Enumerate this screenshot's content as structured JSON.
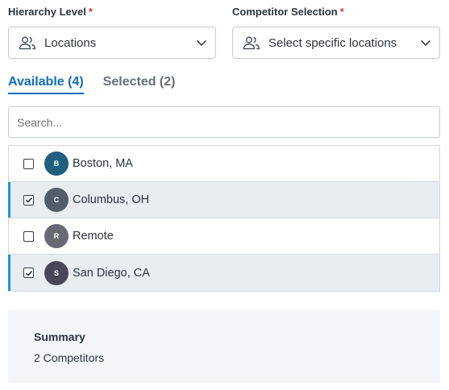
{
  "hierarchy": {
    "label": "Hierarchy Level",
    "required_mark": "*",
    "value": "Locations"
  },
  "competitor": {
    "label": "Competitor Selection",
    "required_mark": "*",
    "value": "Select specific locations"
  },
  "tabs": [
    {
      "label": "Available (4)",
      "active": true
    },
    {
      "label": "Selected (2)",
      "active": false
    }
  ],
  "search": {
    "placeholder": "Search...",
    "value": ""
  },
  "items": [
    {
      "initial": "B",
      "label": "Boston, MA",
      "checked": false,
      "avatar_color": "#1f5f80"
    },
    {
      "initial": "C",
      "label": "Columbus, OH",
      "checked": true,
      "avatar_color": "#535c6a"
    },
    {
      "initial": "R",
      "label": "Remote",
      "checked": false,
      "avatar_color": "#656a74"
    },
    {
      "initial": "S",
      "label": "San Diego, CA",
      "checked": true,
      "avatar_color": "#4a4658"
    }
  ],
  "summary": {
    "title": "Summary",
    "count_text": "2 Competitors"
  },
  "colors": {
    "accent": "#0f6cbd",
    "selection_bar": "#2391dd",
    "required": "#d6333a",
    "selected_row_bg": "#e9edf2"
  },
  "icons": {
    "select_icon": "people-icon",
    "dropdown_icon": "chevron-down-icon",
    "checkbox_icon": "checkmark-icon"
  }
}
